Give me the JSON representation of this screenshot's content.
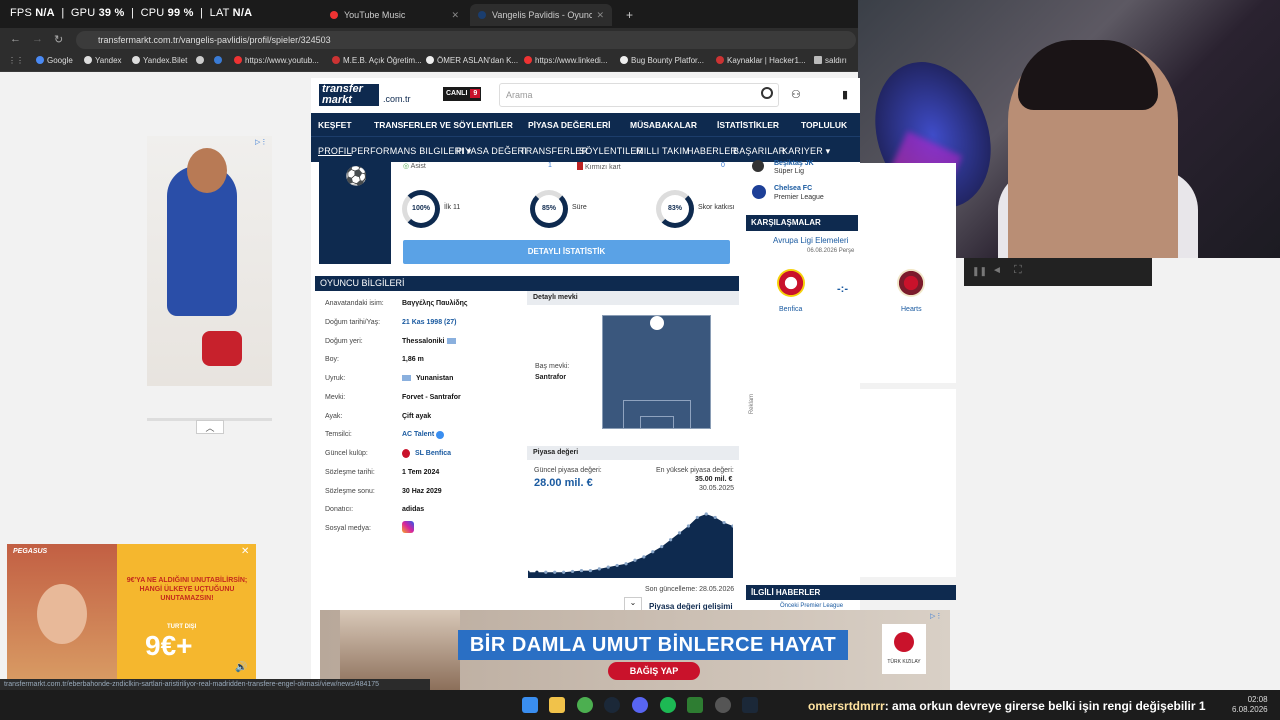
{
  "overlay": {
    "fps_label": "FPS",
    "fps": "N/A",
    "gpu_label": "GPU",
    "gpu": "39 %",
    "cpu_label": "CPU",
    "cpu": "99 %",
    "lat_label": "LAT",
    "lat": "N/A"
  },
  "tabs": [
    {
      "label": "YouTube Music",
      "color": "#e33"
    },
    {
      "label": "Vangelis Pavlidis - Oyuncu p",
      "color": "#1a3d6e"
    }
  ],
  "address": {
    "url": "transfermarkt.com.tr/vangelis-pavlidis/profil/spieler/324503"
  },
  "bookmarks": [
    "Google",
    "Yandex",
    "Yandex.Bilet",
    "https://www.youtub...",
    "M.E.B. Açık Öğretim...",
    "ÖMER ASLAN'dan K...",
    "https://www.linkedi...",
    "Bug Bounty Platfor...",
    "Kaynaklar | Hacker1...",
    "saldırı"
  ],
  "site": {
    "logo": "transfer markt",
    "domain": ".com.tr",
    "canli": "CANLI",
    "canli_count": "9",
    "search_placeholder": "Arama",
    "main_nav": [
      "KEŞFET",
      "TRANSFERLER VE SÖYLENTİLER",
      "PİYASA DEĞERLERİ",
      "MÜSABAKALAR",
      "İSTATİSTİKLER",
      "TOPLULUK"
    ],
    "sub_nav": [
      "Profil",
      "Performans bilgileri ▾",
      "Piyasa değeri",
      "Transferler",
      "Söylentiler",
      "Milli takım",
      "Haberler",
      "Başarılar",
      "Kariyer ▾"
    ],
    "asist": "Asist",
    "asist_val": "1",
    "kirmizi": "Kırmızı kart",
    "kirmizi_val": "0",
    "rings": [
      {
        "pct": "100%",
        "label": "İlk 11"
      },
      {
        "pct": "85%",
        "label": "Süre"
      },
      {
        "pct": "83%",
        "label": "Skor katkısı"
      }
    ],
    "detay_btn": "DETAYLI İSTATİSTİK",
    "info_title": "OYUNCU BİLGİLERİ",
    "info": [
      {
        "l": "Anavatandaki isim:",
        "v": "Βαγγέλης Παυλίδης"
      },
      {
        "l": "Doğum tarihi/Yaş:",
        "v": "21 Kas 1998 (27)"
      },
      {
        "l": "Doğum yeri:",
        "v": "Thessaloniki"
      },
      {
        "l": "Boy:",
        "v": "1,86 m"
      },
      {
        "l": "Uyruk:",
        "v": "Yunanistan"
      },
      {
        "l": "Mevki:",
        "v": "Forvet - Santrafor"
      },
      {
        "l": "Ayak:",
        "v": "Çift ayak"
      },
      {
        "l": "Temsilci:",
        "v": "AC Talent"
      },
      {
        "l": "Güncel kulüp:",
        "v": "SL Benfica"
      },
      {
        "l": "Sözleşme tarihi:",
        "v": "1 Tem 2024"
      },
      {
        "l": "Sözleşme sonu:",
        "v": "30 Haz 2029"
      },
      {
        "l": "Donatıcı:",
        "v": "adidas"
      },
      {
        "l": "Sosyal medya:",
        "v": ""
      }
    ],
    "detay_mevki": "Detaylı mevki",
    "bas_mevki_label": "Baş mevki:",
    "bas_mevki": "Santrafor",
    "piyasa_title": "Piyasa değeri",
    "guncel_label": "Güncel piyasa değeri:",
    "guncel_val": "28.00 mil. €",
    "en_yuksek_label": "En yüksek piyasa değeri:",
    "en_yuksek_val": "35.00 mil. €",
    "en_yuksek_date": "30.05.2025",
    "son_guncelleme": "Son güncelleme: 28.05.2026",
    "gelisim": "Piyasa değeri gelişimi"
  },
  "chart_data": {
    "type": "line",
    "title": "Piyasa değeri",
    "values": [
      1,
      1,
      1,
      1,
      1,
      1.5,
      2,
      2,
      3,
      4,
      5,
      6,
      8,
      10,
      13,
      16,
      20,
      24,
      28,
      33,
      35,
      33,
      30,
      28
    ]
  },
  "right": {
    "club1": "Beşiktaş JK",
    "club1_league": "Süper Lig",
    "club2": "Chelsea FC",
    "club2_league": "Premier League",
    "karsilasmalar": "KARŞILAŞMALAR",
    "match_comp": "Avrupa Ligi Elemeleri",
    "match_date": "06.08.2026 Perşe",
    "home": "Benfica",
    "away": "Hearts",
    "score": "-:-",
    "reklam": "Reklam",
    "ilgili": "İLGİLİ HABERLER",
    "news1": "Önceki Premier League"
  },
  "pegasus": {
    "brand": "PEGASUS",
    "text": "9€'YA NE ALDIĞINI UNUTABİLİRSİN; HANGİ ÜLKEYE UÇTUĞUNU UNUTAMAZSIN!",
    "sub": "TURT DIŞI",
    "price": "9€+"
  },
  "kizilay": {
    "slogan": "BİR DAMLA UMUT BİNLERCE HAYAT",
    "button": "BAĞIŞ YAP",
    "logo": "TÜRK KIZILAY"
  },
  "status_url": "transfermarkt.com.tr/eberbahonde-zndiclkin-sartlari-aristiriliyor-real-madridden-transfere-engel-okmasi/view/news/484175",
  "chat": {
    "user": "omersrtdmrrr",
    "message": ": ama orkun devreye girerse belki işin rengi değişebilir 1"
  },
  "clock": {
    "time": "02:08",
    "date": "6.08.2026"
  }
}
